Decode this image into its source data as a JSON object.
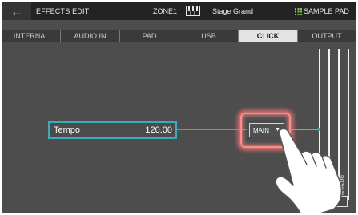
{
  "header": {
    "back_symbol": "←",
    "title": "EFFECTS EDIT",
    "zone": "ZONE1",
    "program": "Stage Grand",
    "sample_pad": "SAMPLE PAD"
  },
  "tabs": [
    {
      "label": "INTERNAL",
      "active": false
    },
    {
      "label": "AUDIO IN",
      "active": false
    },
    {
      "label": "PAD",
      "active": false
    },
    {
      "label": "USB",
      "active": false
    },
    {
      "label": "CLICK",
      "active": true
    },
    {
      "label": "OUTPUT",
      "active": false
    }
  ],
  "routing": {
    "source_label": "Tempo",
    "source_value": "120.00",
    "output_value": "MAIN",
    "bus_vertical_labels": [
      "S",
      "S",
      "ANALOG"
    ],
    "bus_label": "BUS"
  },
  "colors": {
    "accent_cyan": "#3fa9b5",
    "line_orange": "#e08a45",
    "highlight": "#ff8b8b"
  }
}
